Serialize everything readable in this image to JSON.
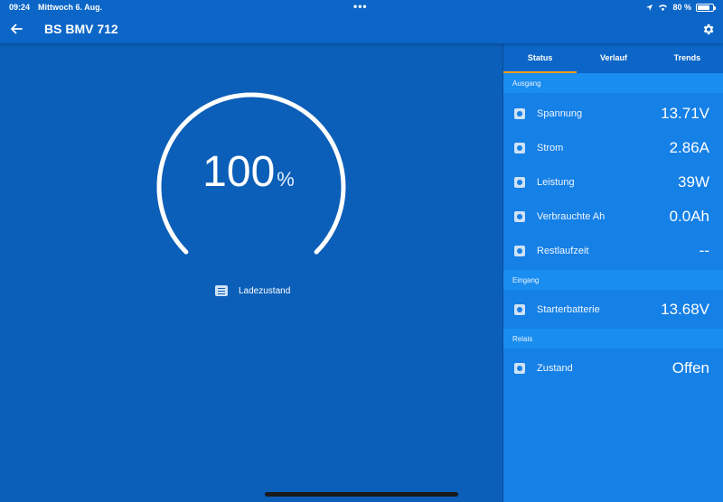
{
  "status_bar": {
    "time": "09:24",
    "date": "Mittwoch 6. Aug.",
    "battery_percent": "80 %",
    "battery_level": 0.8
  },
  "header": {
    "title": "BS BMV 712",
    "back_icon": "arrow-left-icon",
    "settings_icon": "gear-icon"
  },
  "gauge": {
    "value": "100",
    "unit": "%",
    "fill_fraction": 1.0,
    "label": "Ladezustand"
  },
  "tabs": [
    {
      "label": "Status",
      "active": true
    },
    {
      "label": "Verlauf",
      "active": false
    },
    {
      "label": "Trends",
      "active": false
    }
  ],
  "sections": {
    "ausgang": {
      "title": "Ausgang",
      "rows": [
        {
          "label": "Spannung",
          "value": "13.71V",
          "icon": "bolt-icon"
        },
        {
          "label": "Strom",
          "value": "2.86A",
          "icon": "current-icon"
        },
        {
          "label": "Leistung",
          "value": "39W",
          "icon": "power-icon"
        },
        {
          "label": "Verbrauchte Ah",
          "value": "0.0Ah",
          "icon": "consumed-icon"
        },
        {
          "label": "Restlaufzeit",
          "value": "--",
          "icon": "clock-icon"
        }
      ]
    },
    "eingang": {
      "title": "Eingang",
      "rows": [
        {
          "label": "Starterbatterie",
          "value": "13.68V",
          "icon": "battery-icon"
        }
      ]
    },
    "relais": {
      "title": "Relais",
      "rows": [
        {
          "label": "Zustand",
          "value": "Offen",
          "icon": "relay-icon"
        }
      ]
    }
  },
  "colors": {
    "accent": "#f39a1a",
    "header": "#0b66c7",
    "left_bg": "#0b5fb8",
    "right_bg": "#1580e6"
  }
}
